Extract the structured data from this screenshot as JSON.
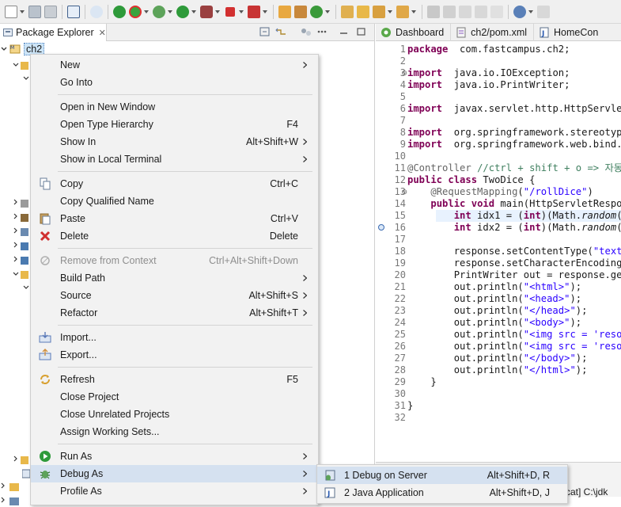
{
  "explorer": {
    "tab_label": "Package Explorer",
    "close_glyph": "✕",
    "selected_project": "ch2"
  },
  "editor": {
    "tabs": [
      {
        "label": "Dashboard",
        "icon": "spring-dashboard-icon"
      },
      {
        "label": "ch2/pom.xml",
        "icon": "maven-pom-icon"
      },
      {
        "label": "HomeCon",
        "icon": "java-class-icon"
      }
    ],
    "line_numbers": [
      "1",
      "2",
      "3",
      "4",
      "5",
      "6",
      "7",
      "8",
      "9",
      "10",
      "11",
      "12",
      "13",
      "14",
      "15",
      "16",
      "17",
      "18",
      "19",
      "20",
      "21",
      "22",
      "23",
      "24",
      "25",
      "26",
      "27",
      "28",
      "29",
      "30",
      "31",
      "32"
    ],
    "fold_markers": {
      "3": "⊖",
      "13": "⊖"
    },
    "lines": [
      [
        [
          "kw",
          "package"
        ],
        [
          "",
          "  com.fastcampus.ch2;"
        ]
      ],
      [],
      [
        [
          "kw",
          "import"
        ],
        [
          "",
          "  java.io.IOException;"
        ]
      ],
      [
        [
          "kw",
          "import"
        ],
        [
          "",
          "  java.io.PrintWriter;"
        ]
      ],
      [],
      [
        [
          "kw",
          "import"
        ],
        [
          "",
          "  javax.servlet.http.HttpServletRe"
        ]
      ],
      [],
      [
        [
          "kw",
          "import"
        ],
        [
          "",
          "  org.springframework.stereotype.C"
        ]
      ],
      [
        [
          "kw",
          "import"
        ],
        [
          "",
          "  org.springframework.web.bind.ann"
        ]
      ],
      [],
      [
        [
          "ann",
          "@Controller"
        ],
        [
          "",
          " "
        ],
        [
          "cm",
          "//ctrl + shift + o => 자동 i"
        ]
      ],
      [
        [
          "kw",
          "public"
        ],
        [
          "",
          " "
        ],
        [
          "kw",
          "class"
        ],
        [
          "",
          " TwoDice {"
        ]
      ],
      [
        [
          "",
          "    "
        ],
        [
          "ann",
          "@RequestMapping"
        ],
        [
          "",
          "("
        ],
        [
          "str",
          "\"/rollDice\""
        ],
        [
          "",
          ")"
        ]
      ],
      [
        [
          "",
          "    "
        ],
        [
          "kw",
          "public"
        ],
        [
          "",
          " "
        ],
        [
          "kw",
          "void"
        ],
        [
          "",
          " main(HttpServletRespons"
        ]
      ],
      [
        [
          "",
          "        "
        ],
        [
          "kw",
          "int"
        ],
        [
          "",
          " idx1 = ("
        ],
        [
          "kw",
          "int"
        ],
        [
          "",
          ")(Math."
        ],
        [
          "it",
          "random"
        ],
        [
          "",
          "()*"
        ]
      ],
      [
        [
          "",
          "        "
        ],
        [
          "kw",
          "int"
        ],
        [
          "",
          " idx2 = ("
        ],
        [
          "kw",
          "int"
        ],
        [
          "",
          ")(Math."
        ],
        [
          "it",
          "random"
        ],
        [
          "",
          "()*"
        ]
      ],
      [],
      [
        [
          "",
          "        response.setContentType("
        ],
        [
          "str",
          "\"text/h"
        ]
      ],
      [
        [
          "",
          "        response.setCharacterEncoding("
        ],
        [
          "str",
          "\""
        ]
      ],
      [
        [
          "",
          "        PrintWriter out = response.getW"
        ]
      ],
      [
        [
          "",
          "        out.println("
        ],
        [
          "str",
          "\"<html>\""
        ],
        [
          "",
          ");"
        ]
      ],
      [
        [
          "",
          "        out.println("
        ],
        [
          "str",
          "\"<head>\""
        ],
        [
          "",
          ");"
        ]
      ],
      [
        [
          "",
          "        out.println("
        ],
        [
          "str",
          "\"</head>\""
        ],
        [
          "",
          ");"
        ]
      ],
      [
        [
          "",
          "        out.println("
        ],
        [
          "str",
          "\"<body>\""
        ],
        [
          "",
          ");"
        ]
      ],
      [
        [
          "",
          "        out.println("
        ],
        [
          "str",
          "\"<img src = 'resour"
        ]
      ],
      [
        [
          "",
          "        out.println("
        ],
        [
          "str",
          "\"<img src = 'resour"
        ]
      ],
      [
        [
          "",
          "        out.println("
        ],
        [
          "str",
          "\"</body>\""
        ],
        [
          "",
          ");"
        ]
      ],
      [
        [
          "",
          "        out.println("
        ],
        [
          "str",
          "\"</html>\""
        ],
        [
          "",
          ");"
        ]
      ],
      [
        [
          "",
          "    }"
        ]
      ],
      [],
      [
        [
          "",
          "}"
        ]
      ],
      []
    ],
    "console_text": "mcat] C:\\jdk"
  },
  "context_menu": {
    "items": [
      {
        "label": "New",
        "shortcut": "",
        "submenu": true,
        "icon": "",
        "disabled": false
      },
      {
        "label": "Go Into",
        "shortcut": "",
        "submenu": false,
        "icon": "",
        "disabled": false
      },
      {
        "sep": true
      },
      {
        "label": "Open in New Window",
        "shortcut": "",
        "submenu": false,
        "icon": "",
        "disabled": false
      },
      {
        "label": "Open Type Hierarchy",
        "shortcut": "F4",
        "submenu": false,
        "icon": "",
        "disabled": false
      },
      {
        "label": "Show In",
        "shortcut": "Alt+Shift+W",
        "submenu": true,
        "icon": "",
        "disabled": false
      },
      {
        "label": "Show in Local Terminal",
        "shortcut": "",
        "submenu": true,
        "icon": "",
        "disabled": false
      },
      {
        "sep": true
      },
      {
        "label": "Copy",
        "shortcut": "Ctrl+C",
        "submenu": false,
        "icon": "copy-icon",
        "disabled": false
      },
      {
        "label": "Copy Qualified Name",
        "shortcut": "",
        "submenu": false,
        "icon": "",
        "disabled": false
      },
      {
        "label": "Paste",
        "shortcut": "Ctrl+V",
        "submenu": false,
        "icon": "paste-icon",
        "disabled": false
      },
      {
        "label": "Delete",
        "shortcut": "Delete",
        "submenu": false,
        "icon": "delete-icon",
        "disabled": false
      },
      {
        "sep": true
      },
      {
        "label": "Remove from Context",
        "shortcut": "Ctrl+Alt+Shift+Down",
        "submenu": false,
        "icon": "remove-context-icon",
        "disabled": true
      },
      {
        "label": "Build Path",
        "shortcut": "",
        "submenu": true,
        "icon": "",
        "disabled": false
      },
      {
        "label": "Source",
        "shortcut": "Alt+Shift+S",
        "submenu": true,
        "icon": "",
        "disabled": false
      },
      {
        "label": "Refactor",
        "shortcut": "Alt+Shift+T",
        "submenu": true,
        "icon": "",
        "disabled": false
      },
      {
        "sep": true
      },
      {
        "label": "Import...",
        "shortcut": "",
        "submenu": false,
        "icon": "import-icon",
        "disabled": false
      },
      {
        "label": "Export...",
        "shortcut": "",
        "submenu": false,
        "icon": "export-icon",
        "disabled": false
      },
      {
        "sep": true
      },
      {
        "label": "Refresh",
        "shortcut": "F5",
        "submenu": false,
        "icon": "refresh-icon",
        "disabled": false
      },
      {
        "label": "Close Project",
        "shortcut": "",
        "submenu": false,
        "icon": "",
        "disabled": false
      },
      {
        "label": "Close Unrelated Projects",
        "shortcut": "",
        "submenu": false,
        "icon": "",
        "disabled": false
      },
      {
        "label": "Assign Working Sets...",
        "shortcut": "",
        "submenu": false,
        "icon": "",
        "disabled": false
      },
      {
        "sep": true
      },
      {
        "label": "Run As",
        "shortcut": "",
        "submenu": true,
        "icon": "run-icon",
        "disabled": false
      },
      {
        "label": "Debug As",
        "shortcut": "",
        "submenu": true,
        "icon": "debug-icon",
        "disabled": false,
        "hover": true
      },
      {
        "label": "Profile As",
        "shortcut": "",
        "submenu": true,
        "icon": "",
        "disabled": false
      }
    ]
  },
  "submenu": {
    "items": [
      {
        "label": "1 Debug on Server",
        "shortcut": "Alt+Shift+D, R",
        "icon": "debug-server-icon"
      },
      {
        "label": "2 Java Application",
        "shortcut": "Alt+Shift+D, J",
        "icon": "java-app-icon"
      }
    ]
  },
  "colors": {
    "accent_selection": "#cce4f7",
    "menu_hover": "#d5e1f0",
    "keyword": "#7f0055",
    "string": "#2a00ff",
    "comment": "#3f7f5f"
  }
}
